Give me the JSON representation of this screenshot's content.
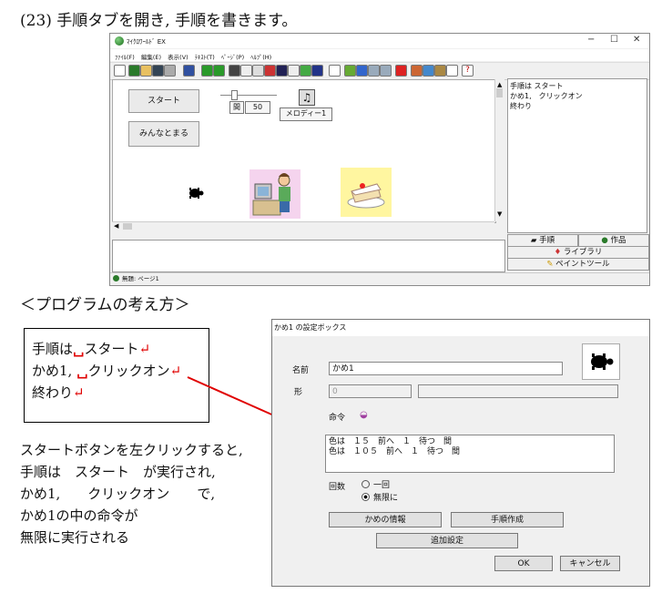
{
  "heading": "(23) 手順タブを開き, 手順を書きます。",
  "app": {
    "title": "ﾏｲｸﾛﾜｰﾙﾄﾞ EX",
    "window_controls": [
      "−",
      "☐",
      "✕"
    ],
    "menu": [
      "ﾌｧｲﾙ(F)",
      "編集(E)",
      "表示(V)",
      "ﾃｷｽﾄ(T)",
      "ﾍﾟｰｼﾞ(P)",
      "ﾍﾙﾌﾟ(H)"
    ],
    "toolbar_question": "?",
    "canvas": {
      "start_button": "スタート",
      "stop_all_button": "みんなとまる",
      "interval_label": "間",
      "interval_value": "50",
      "melody_label": "メロディー1",
      "music_icon": "♫"
    },
    "right_panel": {
      "lines": [
        "手順は スタート",
        "かめ1,　クリックオン",
        "終わり"
      ]
    },
    "tabs": {
      "procedure": "手順",
      "works": "作品",
      "library": "ライブラリ",
      "paint_tool": "ペイントツール"
    },
    "status": "無題: ページ1"
  },
  "concept_heading": "＜プログラムの考え方＞",
  "concept_box": {
    "line1_a": "手順は",
    "line1_space": "␣",
    "line1_b": "スタート",
    "line2_a": "かめ1,",
    "line2_space": "␣",
    "line2_b": "クリックオン",
    "line3": "終わり",
    "return_mark": "↵"
  },
  "explanation": [
    "スタートボタンを左クリックすると,",
    "手順は　スタート　が実行され,",
    "かめ1,　　クリックオン　　で,",
    "かめ1の中の命令が",
    "無限に実行される"
  ],
  "dialog": {
    "title": "かめ1 の設定ボックス",
    "name_label": "名前",
    "name_value": "かめ1",
    "shape_label": "形",
    "shape_value": "0",
    "command_label": "命令",
    "commands": [
      "色は　１５　前へ　１　待つ　間",
      "色は　１０５　前へ　１　待つ　間"
    ],
    "count_label": "回数",
    "once": "一回",
    "infinite": "無限に",
    "turtle_info_button": "かめの情報",
    "make_procedure_button": "手順作成",
    "additional_settings_button": "追加設定",
    "ok_button": "OK",
    "cancel_button": "キャンセル"
  }
}
